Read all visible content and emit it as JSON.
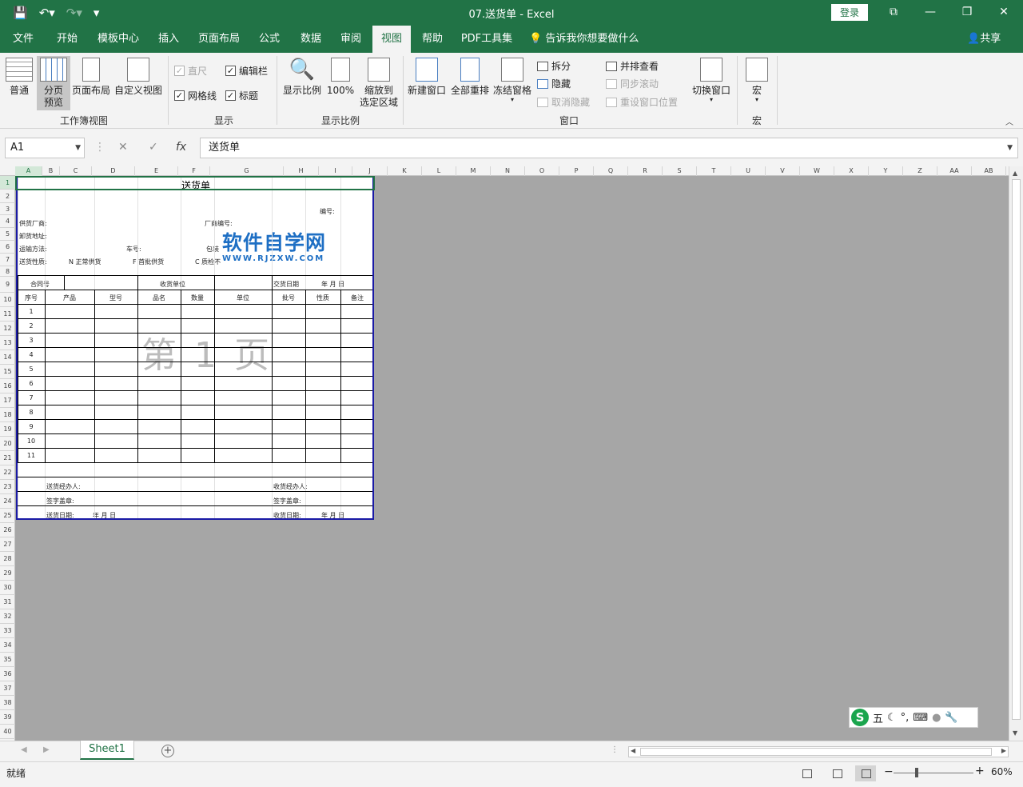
{
  "titlebar": {
    "title": "07.送货单  -  Excel",
    "login": "登录",
    "save_icon": "save-icon",
    "undo_icon": "undo-icon",
    "redo_icon": "redo-icon"
  },
  "tabs": [
    {
      "label": "文件"
    },
    {
      "label": "开始"
    },
    {
      "label": "模板中心"
    },
    {
      "label": "插入"
    },
    {
      "label": "页面布局"
    },
    {
      "label": "公式"
    },
    {
      "label": "数据"
    },
    {
      "label": "审阅"
    },
    {
      "label": "视图"
    },
    {
      "label": "帮助"
    },
    {
      "label": "PDF工具集"
    }
  ],
  "tellme": "告诉我你想要做什么",
  "share": "共享",
  "ribbon": {
    "workbook_views": {
      "label": "工作簿视图",
      "normal": "普通",
      "page_break_1": "分页",
      "page_break_2": "预览",
      "page_layout": "页面布局",
      "custom": "自定义视图"
    },
    "show": {
      "label": "显示",
      "ruler": "直尺",
      "formula_bar": "编辑栏",
      "gridlines": "网格线",
      "headings": "标题"
    },
    "zoom": {
      "label": "显示比例",
      "zoom": "显示比例",
      "hundred": "100%",
      "zoom_sel_1": "缩放到",
      "zoom_sel_2": "选定区域"
    },
    "window": {
      "label": "窗口",
      "new_window": "新建窗口",
      "arrange_all": "全部重排",
      "freeze": "冻结窗格",
      "split": "拆分",
      "hide": "隐藏",
      "unhide": "取消隐藏",
      "side_by_side": "并排查看",
      "sync_scroll": "同步滚动",
      "reset_pos": "重设窗口位置",
      "switch": "切换窗口"
    },
    "macros": {
      "label": "宏",
      "macro": "宏"
    }
  },
  "formula": {
    "namebox": "A1",
    "cancel": "✕",
    "enter": "✓",
    "fx": "fx",
    "value": "送货单"
  },
  "columns": [
    "A",
    "B",
    "C",
    "D",
    "E",
    "F",
    "G",
    "H",
    "I",
    "J",
    "K",
    "L",
    "M",
    "N",
    "O",
    "P",
    "Q",
    "R",
    "S",
    "T",
    "U",
    "V",
    "W",
    "X",
    "Y",
    "Z",
    "AA",
    "AB"
  ],
  "rows": [
    "1",
    "2",
    "3",
    "4",
    "5",
    "6",
    "7",
    "8",
    "9",
    "10",
    "11",
    "12",
    "13",
    "14",
    "15",
    "16",
    "17",
    "18",
    "19",
    "20",
    "21",
    "22",
    "23",
    "24",
    "25",
    "26",
    "27",
    "28",
    "29",
    "30",
    "31",
    "32",
    "33",
    "34",
    "35",
    "36",
    "37",
    "38",
    "39",
    "40"
  ],
  "doc": {
    "title": "送货单",
    "serial": "编号:",
    "supplier": "供货厂商:",
    "vendor_no": "厂商编号:",
    "address": "卸货地址:",
    "transport": "运输方法:",
    "car_no": "车号:",
    "pack": "包装",
    "nature": "送货性质:",
    "n_normal": "N 正常供货",
    "f_first": "F 首批供货",
    "c_check": "C 质检不",
    "contract": "合同号",
    "receiver": "收货单位",
    "delivery_date": "交货日期",
    "ymd": "年    月    日",
    "headers": [
      "序号",
      "产品",
      "型号",
      "品名",
      "数量",
      "单位",
      "批号",
      "性质",
      "备注"
    ],
    "items": [
      "1",
      "2",
      "3",
      "4",
      "5",
      "6",
      "7",
      "8",
      "9",
      "10",
      "11"
    ],
    "sender_mgr": "送货经办人:",
    "sign_seal": "签字盖章:",
    "send_date": "送货日期:",
    "send_ymd": "年    月    日",
    "recv_mgr": "收货经办人:",
    "recv_seal": "签字盖章:",
    "recv_date": "收货日期:",
    "recv_ymd": "年    月    日",
    "page_watermark": "第 1 页"
  },
  "site_logo": {
    "name": "软件自学网",
    "url_text": "WWW.RJZXW.COM"
  },
  "ime": {
    "logo": "S",
    "mode": "五"
  },
  "sheets": {
    "active": "Sheet1"
  },
  "status": {
    "ready": "就绪",
    "zoom": "60%"
  }
}
